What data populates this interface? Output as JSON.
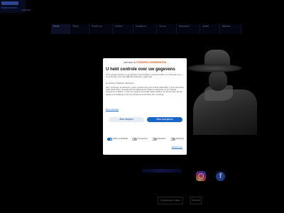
{
  "site": {
    "logo_sub": "Inspiration"
  },
  "nav": {
    "items": [
      "Home",
      "Tilbud",
      "Hvorfor os",
      "Service",
      "Kontakt os",
      "Om os",
      "Reference",
      "Galleri",
      "Nyheder"
    ]
  },
  "consent": {
    "brand": "one.com",
    "brand_connector": "&",
    "brand_partner": "CONSENT GENERATION",
    "title": "U hebt controle over uw gegevens",
    "para1": "Onze website partners en wij gebruiken technologieën, inclusief cookies, om informatie over u te verzamelen voor verschillende doeleinden, waaronder:",
    "para2": "Functioneel, Statistisch, Marketing",
    "para3": "Door ‘Accepteer’ te selecteren, geeft u toestemming voor al deze doeleinden. U kunt ook kiezen welke doeleinden u toestaat door de bijbehorende vinkjes te selecteren en op ‘Selectie accepteren’ te klikken. U kunt uw toestemming te allen tijde intrekken via de link onder aan de pagina. Uw beslissing is niet van invloed op de diensten die u ontvangt.",
    "learn_more": "Meer informatie",
    "deny_label": "Alles afwijzen",
    "accept_label": "Alles accepteren",
    "toggles": [
      {
        "label": "Strikt noodzakelijk",
        "on": true
      },
      {
        "label": "Functioneel",
        "on": false
      },
      {
        "label": "Statistisch",
        "on": false
      },
      {
        "label": "Marketing",
        "on": false
      }
    ],
    "details_label": "Details tonen"
  },
  "footer": {
    "pages_label": "Netværksnavn mappe",
    "small_label": "DGA bilt"
  },
  "colors": {
    "accent": "#1a66c7",
    "brand_orange": "#e65b12",
    "background": "#000000"
  },
  "icons": {
    "instagram": "instagram-icon",
    "facebook": "facebook-icon"
  }
}
